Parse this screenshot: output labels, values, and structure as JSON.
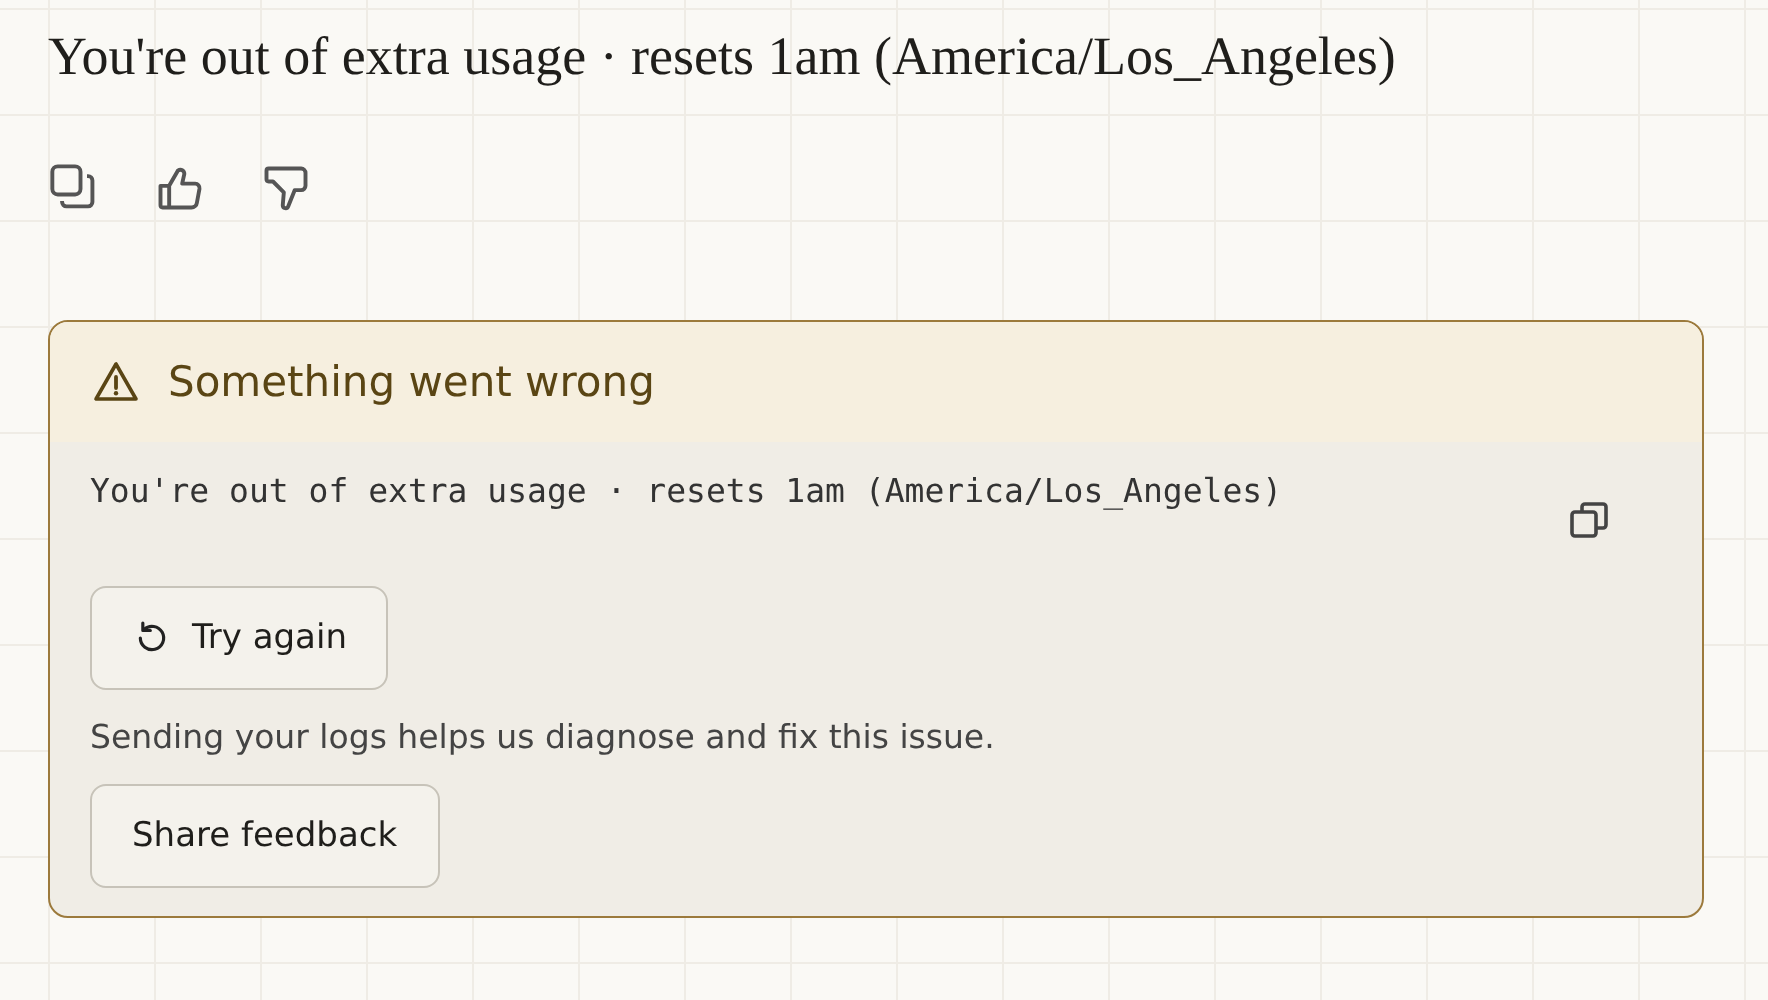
{
  "message": {
    "text": "You're out of extra usage · resets 1am (America/Los_Angeles)"
  },
  "error_card": {
    "title": "Something went wrong",
    "detail": "You're out of extra usage · resets 1am (America/Los_Angeles)",
    "retry_button": "Try again",
    "logs_note": "Sending your logs helps us diagnose and fix this issue.",
    "feedback_button": "Share feedback"
  }
}
